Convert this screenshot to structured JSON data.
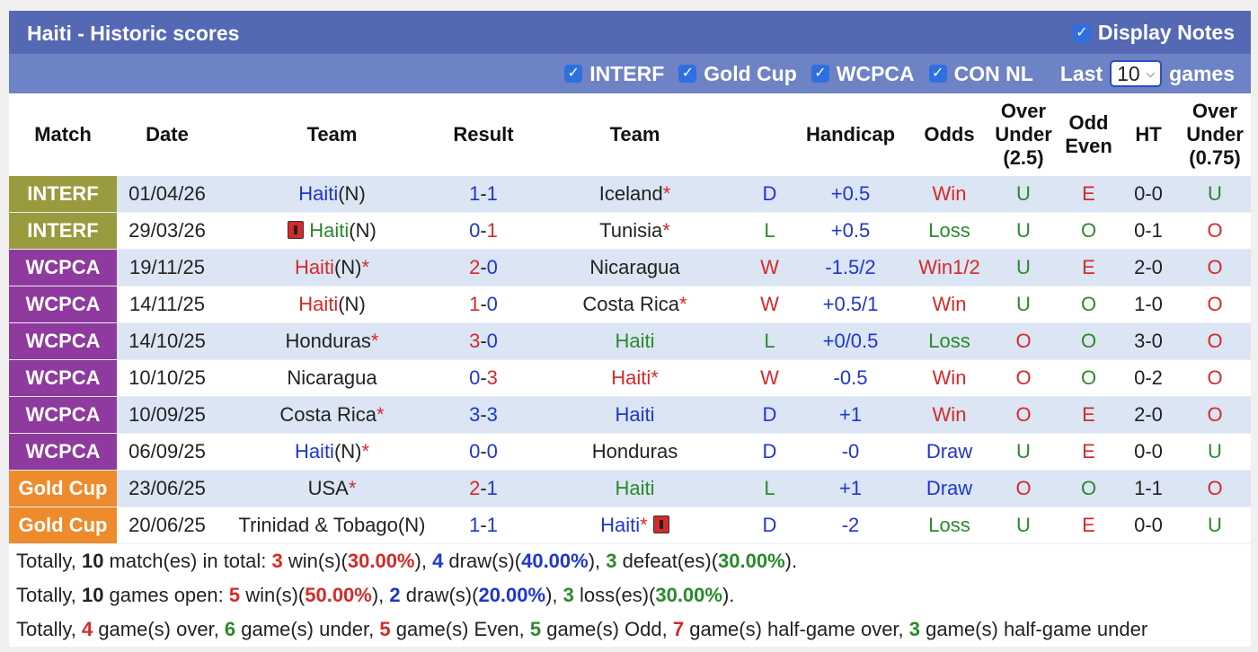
{
  "header": {
    "title": "Haiti - Historic scores",
    "display_notes": "Display Notes"
  },
  "filters": {
    "items": [
      "INTERF",
      "Gold Cup",
      "WCPCA",
      "CON NL"
    ],
    "last_label": "Last",
    "last_value": "10",
    "games_label": "games"
  },
  "columns": {
    "match": "Match",
    "date": "Date",
    "team1": "Team",
    "result": "Result",
    "team2": "Team",
    "handicap": "Handicap",
    "odds": "Odds",
    "ou": [
      "Over",
      "Under",
      "(2.5)"
    ],
    "oe": [
      "Odd",
      "Even"
    ],
    "ht": "HT",
    "ou2": [
      "Over",
      "Under",
      "(0.75)"
    ]
  },
  "colors": {
    "INTERF": "#9a9a3e",
    "WCPCA": "#8e3a9e",
    "Gold Cup": "#ee8b2c",
    "title_bar": "#5468b4",
    "filter_bar": "#6e82c6"
  },
  "rows": [
    {
      "league": "INTERF",
      "date": "01/04/26",
      "home": "Haiti",
      "home_suffix": "(N)",
      "home_star": false,
      "home_card": false,
      "home_color": "blue",
      "hg": "1",
      "hg_color": "blue",
      "ag": "1",
      "ag_color": "blue",
      "away": "Iceland",
      "away_suffix": "",
      "away_star": true,
      "away_card": false,
      "away_color": "dark",
      "wdl": "D",
      "wdl_color": "blue",
      "handicap": "+0.5",
      "odds": "Win",
      "odds_color": "red",
      "ou": "U",
      "ou_color": "green",
      "oe": "E",
      "oe_color": "red",
      "ht": "0-0",
      "ou2": "U",
      "ou2_color": "green"
    },
    {
      "league": "INTERF",
      "date": "29/03/26",
      "home": "Haiti",
      "home_suffix": "(N)",
      "home_star": false,
      "home_card": true,
      "home_color": "green",
      "hg": "0",
      "hg_color": "blue",
      "ag": "1",
      "ag_color": "red",
      "away": "Tunisia",
      "away_suffix": "",
      "away_star": true,
      "away_card": false,
      "away_color": "dark",
      "wdl": "L",
      "wdl_color": "green",
      "handicap": "+0.5",
      "odds": "Loss",
      "odds_color": "green",
      "ou": "U",
      "ou_color": "green",
      "oe": "O",
      "oe_color": "green",
      "ht": "0-1",
      "ou2": "O",
      "ou2_color": "red"
    },
    {
      "league": "WCPCA",
      "date": "19/11/25",
      "home": "Haiti",
      "home_suffix": "(N)",
      "home_star": true,
      "home_card": false,
      "home_color": "red",
      "hg": "2",
      "hg_color": "red",
      "ag": "0",
      "ag_color": "blue",
      "away": "Nicaragua",
      "away_suffix": "",
      "away_star": false,
      "away_card": false,
      "away_color": "dark",
      "wdl": "W",
      "wdl_color": "red",
      "handicap": "-1.5/2",
      "odds": "Win1/2",
      "odds_color": "red",
      "ou": "U",
      "ou_color": "green",
      "oe": "E",
      "oe_color": "red",
      "ht": "2-0",
      "ou2": "O",
      "ou2_color": "red"
    },
    {
      "league": "WCPCA",
      "date": "14/11/25",
      "home": "Haiti",
      "home_suffix": "(N)",
      "home_star": false,
      "home_card": false,
      "home_color": "red",
      "hg": "1",
      "hg_color": "red",
      "ag": "0",
      "ag_color": "blue",
      "away": "Costa Rica",
      "away_suffix": "",
      "away_star": true,
      "away_card": false,
      "away_color": "dark",
      "wdl": "W",
      "wdl_color": "red",
      "handicap": "+0.5/1",
      "odds": "Win",
      "odds_color": "red",
      "ou": "U",
      "ou_color": "green",
      "oe": "O",
      "oe_color": "green",
      "ht": "1-0",
      "ou2": "O",
      "ou2_color": "red"
    },
    {
      "league": "WCPCA",
      "date": "14/10/25",
      "home": "Honduras",
      "home_suffix": "",
      "home_star": true,
      "home_card": false,
      "home_color": "dark",
      "hg": "3",
      "hg_color": "red",
      "ag": "0",
      "ag_color": "blue",
      "away": "Haiti",
      "away_suffix": "",
      "away_star": false,
      "away_card": false,
      "away_color": "green",
      "wdl": "L",
      "wdl_color": "green",
      "handicap": "+0/0.5",
      "odds": "Loss",
      "odds_color": "green",
      "ou": "O",
      "ou_color": "red",
      "oe": "O",
      "oe_color": "green",
      "ht": "3-0",
      "ou2": "O",
      "ou2_color": "red"
    },
    {
      "league": "WCPCA",
      "date": "10/10/25",
      "home": "Nicaragua",
      "home_suffix": "",
      "home_star": false,
      "home_card": false,
      "home_color": "dark",
      "hg": "0",
      "hg_color": "blue",
      "ag": "3",
      "ag_color": "red",
      "away": "Haiti",
      "away_suffix": "",
      "away_star": true,
      "away_card": false,
      "away_color": "red",
      "wdl": "W",
      "wdl_color": "red",
      "handicap": "-0.5",
      "odds": "Win",
      "odds_color": "red",
      "ou": "O",
      "ou_color": "red",
      "oe": "O",
      "oe_color": "green",
      "ht": "0-2",
      "ou2": "O",
      "ou2_color": "red"
    },
    {
      "league": "WCPCA",
      "date": "10/09/25",
      "home": "Costa Rica",
      "home_suffix": "",
      "home_star": true,
      "home_card": false,
      "home_color": "dark",
      "hg": "3",
      "hg_color": "blue",
      "ag": "3",
      "ag_color": "blue",
      "away": "Haiti",
      "away_suffix": "",
      "away_star": false,
      "away_card": false,
      "away_color": "blue",
      "wdl": "D",
      "wdl_color": "blue",
      "handicap": "+1",
      "odds": "Win",
      "odds_color": "red",
      "ou": "O",
      "ou_color": "red",
      "oe": "E",
      "oe_color": "red",
      "ht": "2-0",
      "ou2": "O",
      "ou2_color": "red"
    },
    {
      "league": "WCPCA",
      "date": "06/09/25",
      "home": "Haiti",
      "home_suffix": "(N)",
      "home_star": true,
      "home_card": false,
      "home_color": "blue",
      "hg": "0",
      "hg_color": "blue",
      "ag": "0",
      "ag_color": "blue",
      "away": "Honduras",
      "away_suffix": "",
      "away_star": false,
      "away_card": false,
      "away_color": "dark",
      "wdl": "D",
      "wdl_color": "blue",
      "handicap": "-0",
      "odds": "Draw",
      "odds_color": "blue",
      "ou": "U",
      "ou_color": "green",
      "oe": "E",
      "oe_color": "red",
      "ht": "0-0",
      "ou2": "U",
      "ou2_color": "green"
    },
    {
      "league": "Gold Cup",
      "date": "23/06/25",
      "home": "USA",
      "home_suffix": "",
      "home_star": true,
      "home_card": false,
      "home_color": "dark",
      "hg": "2",
      "hg_color": "red",
      "ag": "1",
      "ag_color": "blue",
      "away": "Haiti",
      "away_suffix": "",
      "away_star": false,
      "away_card": false,
      "away_color": "green",
      "wdl": "L",
      "wdl_color": "green",
      "handicap": "+1",
      "odds": "Draw",
      "odds_color": "blue",
      "ou": "O",
      "ou_color": "red",
      "oe": "O",
      "oe_color": "green",
      "ht": "1-1",
      "ou2": "O",
      "ou2_color": "red"
    },
    {
      "league": "Gold Cup",
      "date": "20/06/25",
      "home": "Trinidad & Tobago",
      "home_suffix": "(N)",
      "home_star": false,
      "home_card": false,
      "home_color": "dark",
      "hg": "1",
      "hg_color": "blue",
      "ag": "1",
      "ag_color": "blue",
      "away": "Haiti",
      "away_suffix": "",
      "away_star": true,
      "away_card": true,
      "away_color": "blue",
      "wdl": "D",
      "wdl_color": "blue",
      "handicap": "-2",
      "odds": "Loss",
      "odds_color": "green",
      "ou": "U",
      "ou_color": "green",
      "oe": "E",
      "oe_color": "red",
      "ht": "0-0",
      "ou2": "U",
      "ou2_color": "green"
    }
  ],
  "summary": [
    [
      {
        "t": "Totally, ",
        "c": "dark"
      },
      {
        "t": "10",
        "c": "dark",
        "b": true
      },
      {
        "t": " match(es) in total: ",
        "c": "dark"
      },
      {
        "t": "3",
        "c": "red",
        "b": true
      },
      {
        "t": " win(s)(",
        "c": "dark"
      },
      {
        "t": "30.00%",
        "c": "red",
        "b": true
      },
      {
        "t": "), ",
        "c": "dark"
      },
      {
        "t": "4",
        "c": "blue",
        "b": true
      },
      {
        "t": " draw(s)(",
        "c": "dark"
      },
      {
        "t": "40.00%",
        "c": "blue",
        "b": true
      },
      {
        "t": "), ",
        "c": "dark"
      },
      {
        "t": "3",
        "c": "green",
        "b": true
      },
      {
        "t": " defeat(es)(",
        "c": "dark"
      },
      {
        "t": "30.00%",
        "c": "green",
        "b": true
      },
      {
        "t": ").",
        "c": "dark"
      }
    ],
    [
      {
        "t": "Totally, ",
        "c": "dark"
      },
      {
        "t": "10",
        "c": "dark",
        "b": true
      },
      {
        "t": " games open: ",
        "c": "dark"
      },
      {
        "t": "5",
        "c": "red",
        "b": true
      },
      {
        "t": " win(s)(",
        "c": "dark"
      },
      {
        "t": "50.00%",
        "c": "red",
        "b": true
      },
      {
        "t": "), ",
        "c": "dark"
      },
      {
        "t": "2",
        "c": "blue",
        "b": true
      },
      {
        "t": " draw(s)(",
        "c": "dark"
      },
      {
        "t": "20.00%",
        "c": "blue",
        "b": true
      },
      {
        "t": "), ",
        "c": "dark"
      },
      {
        "t": "3",
        "c": "green",
        "b": true
      },
      {
        "t": " loss(es)(",
        "c": "dark"
      },
      {
        "t": "30.00%",
        "c": "green",
        "b": true
      },
      {
        "t": ").",
        "c": "dark"
      }
    ],
    [
      {
        "t": "Totally, ",
        "c": "dark"
      },
      {
        "t": "4",
        "c": "red",
        "b": true
      },
      {
        "t": " game(s) over, ",
        "c": "dark"
      },
      {
        "t": "6",
        "c": "green",
        "b": true
      },
      {
        "t": " game(s) under, ",
        "c": "dark"
      },
      {
        "t": "5",
        "c": "red",
        "b": true
      },
      {
        "t": " game(s) Even, ",
        "c": "dark"
      },
      {
        "t": "5",
        "c": "green",
        "b": true
      },
      {
        "t": " game(s) Odd, ",
        "c": "dark"
      },
      {
        "t": "7",
        "c": "red",
        "b": true
      },
      {
        "t": " game(s) half-game over, ",
        "c": "dark"
      },
      {
        "t": "3",
        "c": "green",
        "b": true
      },
      {
        "t": " game(s) half-game under",
        "c": "dark"
      }
    ]
  ]
}
